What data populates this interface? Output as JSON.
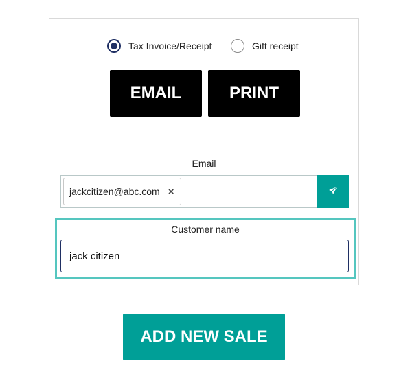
{
  "receipt_options": {
    "tax_invoice": {
      "label": "Tax Invoice/Receipt",
      "selected": true
    },
    "gift_receipt": {
      "label": "Gift receipt",
      "selected": false
    }
  },
  "actions": {
    "email_label": "EMAIL",
    "print_label": "PRINT"
  },
  "email": {
    "label": "Email",
    "chip": "jackcitizen@abc.com",
    "remove_glyph": "×",
    "send_icon": "paper-plane-icon"
  },
  "customer": {
    "label": "Customer name",
    "value": "jack citizen"
  },
  "footer": {
    "add_sale_label": "ADD NEW SALE"
  },
  "colors": {
    "teal": "#009f97",
    "teal_highlight": "#55c6bf",
    "navy": "#1f2f63",
    "black": "#000000"
  }
}
